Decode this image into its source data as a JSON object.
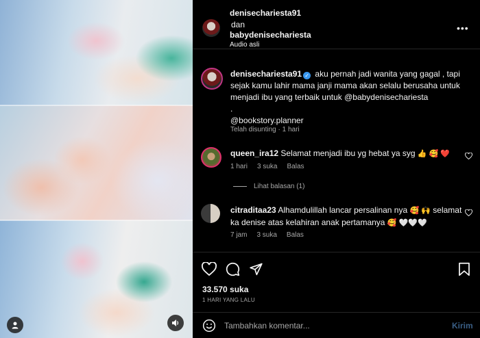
{
  "post": {
    "author": "denisechariesta91",
    "and_word": "dan",
    "collaborator": "babydenisechariesta",
    "audio": "Audio asli",
    "more_icon": "more-horizontal-icon"
  },
  "caption": {
    "username": "denisechariesta91",
    "verified_icon": "verified-badge-icon",
    "text": "aku pernah jadi wanita yang gagal , tapi sejak kamu lahir mama janji mama akan selalu berusaha untuk menjadi ibu yang terbaik untuk @babydenisechariesta",
    "dot": ".",
    "mention": "@bookstory.planner",
    "meta": "Telah disunting · 1 hari"
  },
  "comments": [
    {
      "username": "queen_ira12",
      "text": "Selamat menjadi ibu yg hebat ya syg",
      "emoji": "👍 🥰 ❤️",
      "time": "1 hari",
      "likes": "3 suka",
      "reply": "Balas"
    },
    {
      "username": "citraditaa23",
      "text": "Alhamdulillah lancar persalinan nya",
      "emoji_mid": "🥰 🙌",
      "text2": "selamat ka denise atas kelahiran anak pertamanya",
      "emoji_end": "🥰 🤍🤍🤍",
      "time": "7 jam",
      "likes": "3 suka",
      "reply": "Balas"
    }
  ],
  "view_replies": "Lihat balasan (1)",
  "likes": "33.570 suka",
  "date": "1 HARI YANG LALU",
  "composer": {
    "placeholder": "Tambahkan komentar...",
    "post_label": "Kirim"
  },
  "icons": [
    "heart-icon",
    "comment-icon",
    "share-icon",
    "bookmark-icon",
    "emoji-icon",
    "tag-user-icon",
    "mute-icon"
  ],
  "colors": {
    "background": "#000000",
    "text": "#f5f5f5",
    "muted": "#a8a8a8",
    "verified": "#3897f0",
    "post_button": "#3a5f86"
  }
}
